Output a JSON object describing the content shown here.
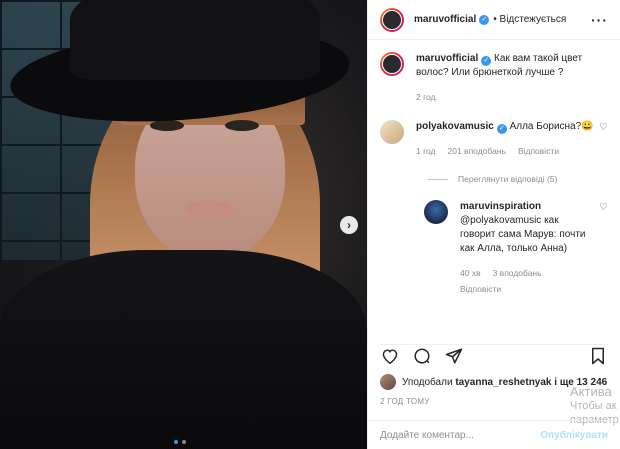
{
  "post": {
    "username": "maruvofficial",
    "follow_status": "• Відстежується"
  },
  "caption": {
    "username": "maruvofficial",
    "text": "Как вам такой цвет волос? Или брюнеткой лучше ?",
    "time": "2 год."
  },
  "comments": [
    {
      "username": "polyakovamusic",
      "text": "Алла Борисна?😀",
      "time": "1 год",
      "likes": "201 вподобань",
      "reply": "Відповісти"
    }
  ],
  "view_replies": "Переглянути відповіді (5)",
  "reply": {
    "username": "maruvinspiration",
    "text": "@polyakovamusic как говорит сама Марув: почти как Алла, только Анна)",
    "time": "40 хв",
    "likes": "3 вподобань",
    "reply": "Відповісти"
  },
  "likes_line": {
    "prefix": "Уподобали",
    "user": "tayanna_reshetnyak",
    "suffix": "і ще 13 246"
  },
  "timestamp": "2 ГОД ТОМУ",
  "add_comment": {
    "placeholder": "Додайте коментар...",
    "publish": "Опублікувати"
  },
  "watermark": {
    "line1": "Актива",
    "line2": "Чтобы ак",
    "line3": "параметр"
  },
  "icons": {
    "heart": "heart-icon",
    "comment": "comment-icon",
    "share": "share-icon",
    "bookmark": "bookmark-icon",
    "more": "more-icon",
    "next": "chevron-right-icon",
    "verified": "verified-icon"
  },
  "colors": {
    "accent": "#3897f0",
    "muted": "#8e8e8e"
  }
}
